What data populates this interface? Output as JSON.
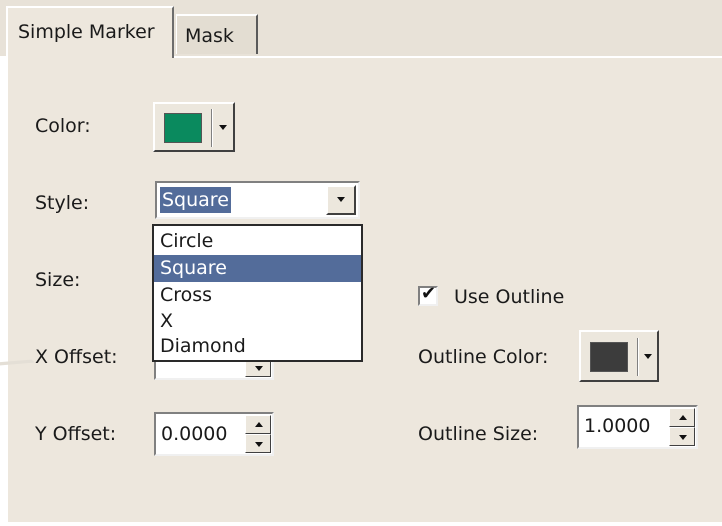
{
  "tabs": [
    {
      "label": "Simple Marker",
      "active": true
    },
    {
      "label": "Mask",
      "active": false
    }
  ],
  "color": {
    "label": "Color:",
    "value": "#0a8a5e"
  },
  "style": {
    "label": "Style:",
    "selected": "Square",
    "options": [
      "Circle",
      "Square",
      "Cross",
      "X",
      "Diamond"
    ]
  },
  "size": {
    "label": "Size:"
  },
  "use_outline": {
    "label": "Use Outline",
    "checked": true
  },
  "x_offset": {
    "label": "X Offset:"
  },
  "outline_color": {
    "label": "Outline Color:",
    "value": "#3c3c3c"
  },
  "y_offset": {
    "label": "Y Offset:",
    "value": "0.0000"
  },
  "outline_size": {
    "label": "Outline Size:",
    "value": "1.0000"
  },
  "colors": {
    "panel": "#ede7dd",
    "highlight": "#536c9a"
  },
  "icons": {
    "dropdown_arrow": "chevron-down-icon",
    "spin_up": "arrow-up-icon",
    "spin_down": "arrow-down-icon",
    "check": "check-icon"
  }
}
